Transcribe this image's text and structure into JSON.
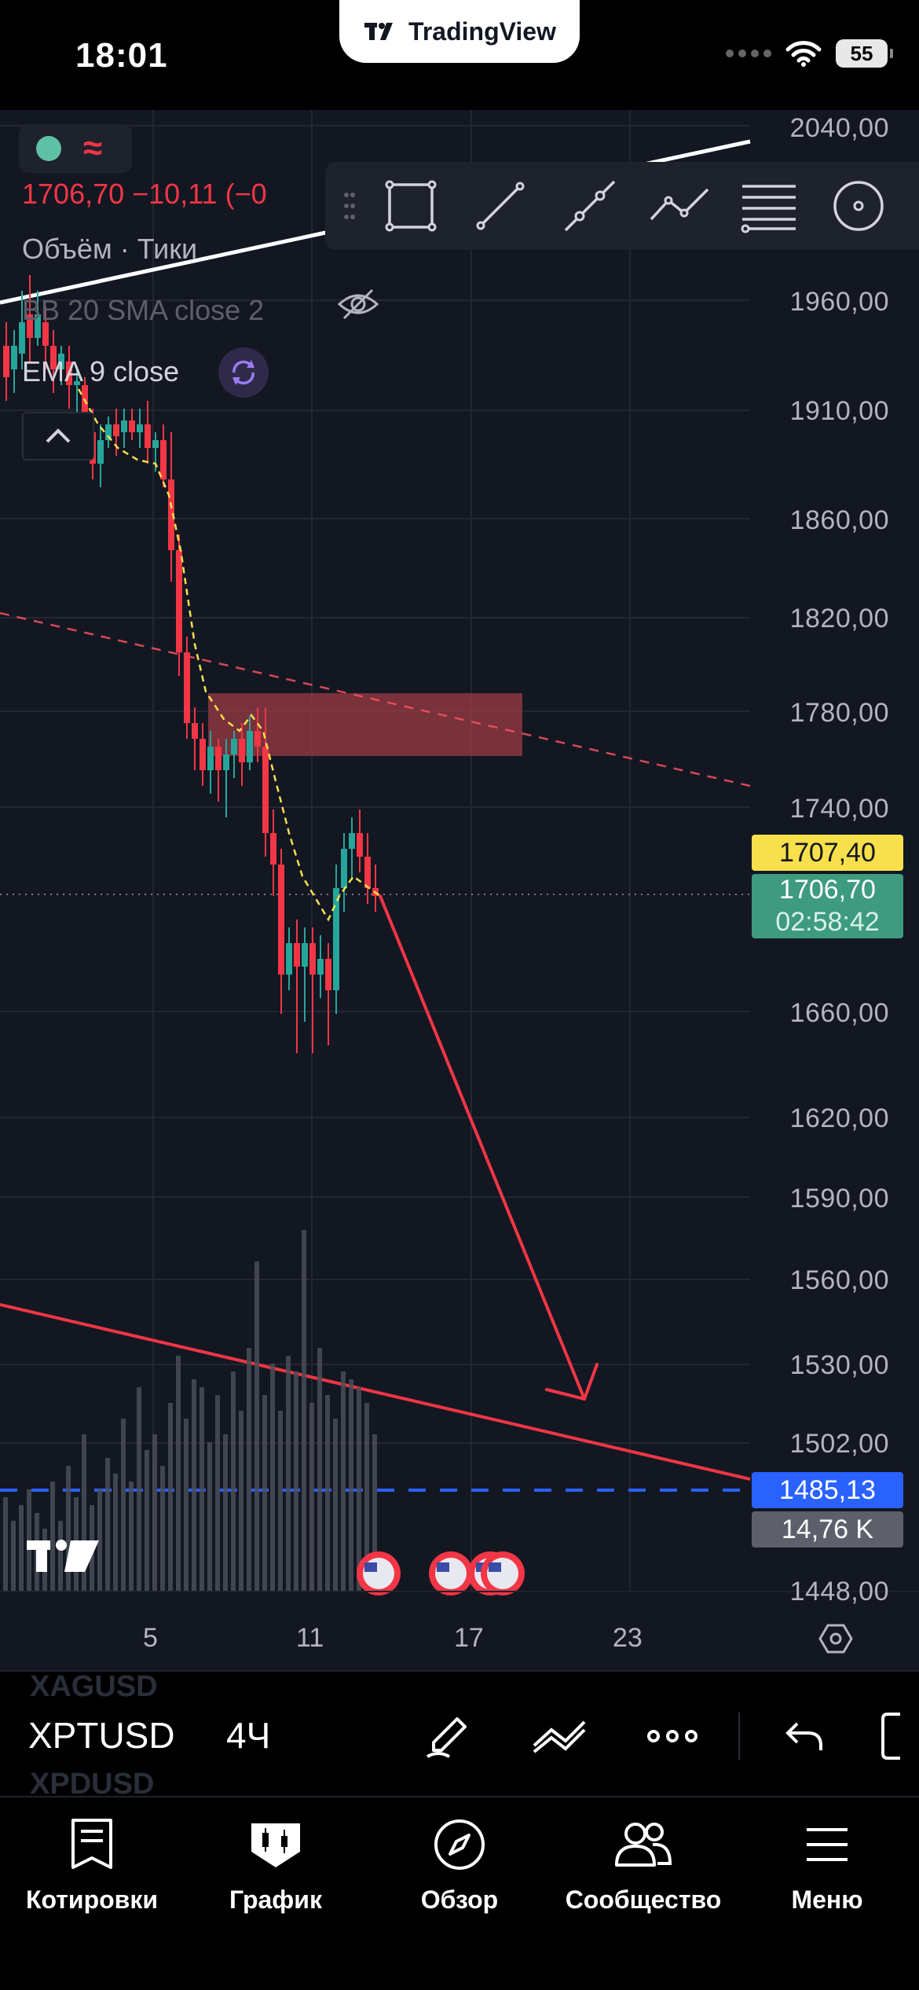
{
  "status_bar": {
    "time": "18:01",
    "app_badge": "TradingView",
    "battery": "55"
  },
  "legend": {
    "price": "1706,70  −10,11 (−0",
    "volume": "Объём · Тики",
    "bb": "BB 20 SMA close 2",
    "ema": "EMA 9 close"
  },
  "price_axis": {
    "labels": [
      "2040,00",
      "1960,00",
      "1910,00",
      "1860,00",
      "1820,00",
      "1780,00",
      "1740,00",
      "1660,00",
      "1620,00",
      "1590,00",
      "1560,00",
      "1530,00",
      "1502,00",
      "1448,00"
    ]
  },
  "time_axis": {
    "labels": [
      "5",
      "11",
      "17",
      "23"
    ]
  },
  "badges": {
    "alert_price": "1707,40",
    "last_price": "1706,70",
    "countdown": "02:58:42",
    "line_price": "1485,13",
    "volume": "14,76 K"
  },
  "drawing_tools": [
    "rectangle-icon",
    "trendline-icon",
    "ray-icon",
    "path-icon",
    "fib-icon",
    "circle-icon"
  ],
  "symbol_bar": {
    "previous_symbol": "XAGUSD",
    "symbol": "XPTUSD",
    "next_symbol": "XPDUSD",
    "interval": "4Ч"
  },
  "tabs": [
    {
      "label": "Котировки",
      "icon": "quotes-icon"
    },
    {
      "label": "График",
      "icon": "chart-icon"
    },
    {
      "label": "Обзор",
      "icon": "compass-icon"
    },
    {
      "label": "Сообщество",
      "icon": "community-icon"
    },
    {
      "label": "Меню",
      "icon": "menu-icon"
    }
  ],
  "colors": {
    "background": "#131722",
    "up": "#26a69a",
    "down": "#f23645",
    "alert_badge": "#f7e04b",
    "last_price_badge": "#3e9b7f",
    "line_badge": "#2962ff",
    "zone": "#9c3b44"
  },
  "chart_data": {
    "type": "candlestick",
    "symbol": "XPTUSD",
    "interval": "4Ч",
    "x_ticks": [
      "5",
      "11",
      "17",
      "23"
    ],
    "ylim": [
      1448,
      2040
    ],
    "last_close": 1706.7,
    "alert_level": 1707.4,
    "horizontal_line": 1485.13,
    "resistance_zone": [
      1765,
      1790
    ],
    "trend_high": 1706.7,
    "trend_low": 1490,
    "series": [
      {
        "name": "EMA 9 close",
        "type": "line"
      },
      {
        "name": "Объём · Тики",
        "type": "bar"
      }
    ]
  }
}
